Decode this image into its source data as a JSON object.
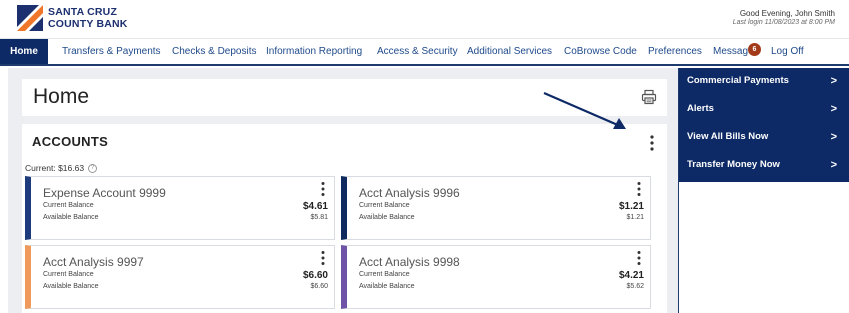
{
  "brand": {
    "line1": "SANTA CRUZ",
    "line2": "COUNTY BANK",
    "logo_colors": [
      "#f0772a",
      "#1c2f6e"
    ]
  },
  "header": {
    "greeting": "Good Evening, John Smith",
    "last_login": "Last login 11/08/2023 at 8:00 PM"
  },
  "nav": {
    "items": [
      {
        "label": "Home"
      },
      {
        "label": "Transfers & Payments"
      },
      {
        "label": "Checks & Deposits"
      },
      {
        "label": "Information Reporting"
      },
      {
        "label": "Access & Security"
      },
      {
        "label": "Additional Services"
      },
      {
        "label": "CoBrowse Code"
      },
      {
        "label": "Preferences"
      },
      {
        "label": "Messages"
      },
      {
        "label": "Log Off"
      }
    ],
    "messages_badge": "6",
    "active_color": "#0d2a66"
  },
  "page": {
    "title": "Home",
    "print_icon": "printer-icon"
  },
  "accounts": {
    "title": "ACCOUNTS",
    "current_total": "Current: $16.63",
    "help_icon": "help-circle-icon",
    "labels": {
      "current": "Current Balance",
      "available": "Available Balance"
    },
    "tiles": [
      {
        "name": "Expense Account 9999",
        "current": "$4.61",
        "available": "$5.81",
        "color": "#1c3a7c"
      },
      {
        "name": "Acct Analysis 9996",
        "current": "$1.21",
        "available": "$1.21",
        "color": "#0f2a5e"
      },
      {
        "name": "Acct Analysis 9997",
        "current": "$6.60",
        "available": "$6.60",
        "color": "#ef9a5c"
      },
      {
        "name": "Acct Analysis 9998",
        "current": "$4.21",
        "available": "$5.62",
        "color": "#6e53a6"
      }
    ]
  },
  "sidebar": {
    "items": [
      {
        "label": "Commercial Payments"
      },
      {
        "label": "Alerts"
      },
      {
        "label": "View All Bills Now"
      },
      {
        "label": "Transfer Money Now"
      }
    ],
    "chevron": ">"
  }
}
